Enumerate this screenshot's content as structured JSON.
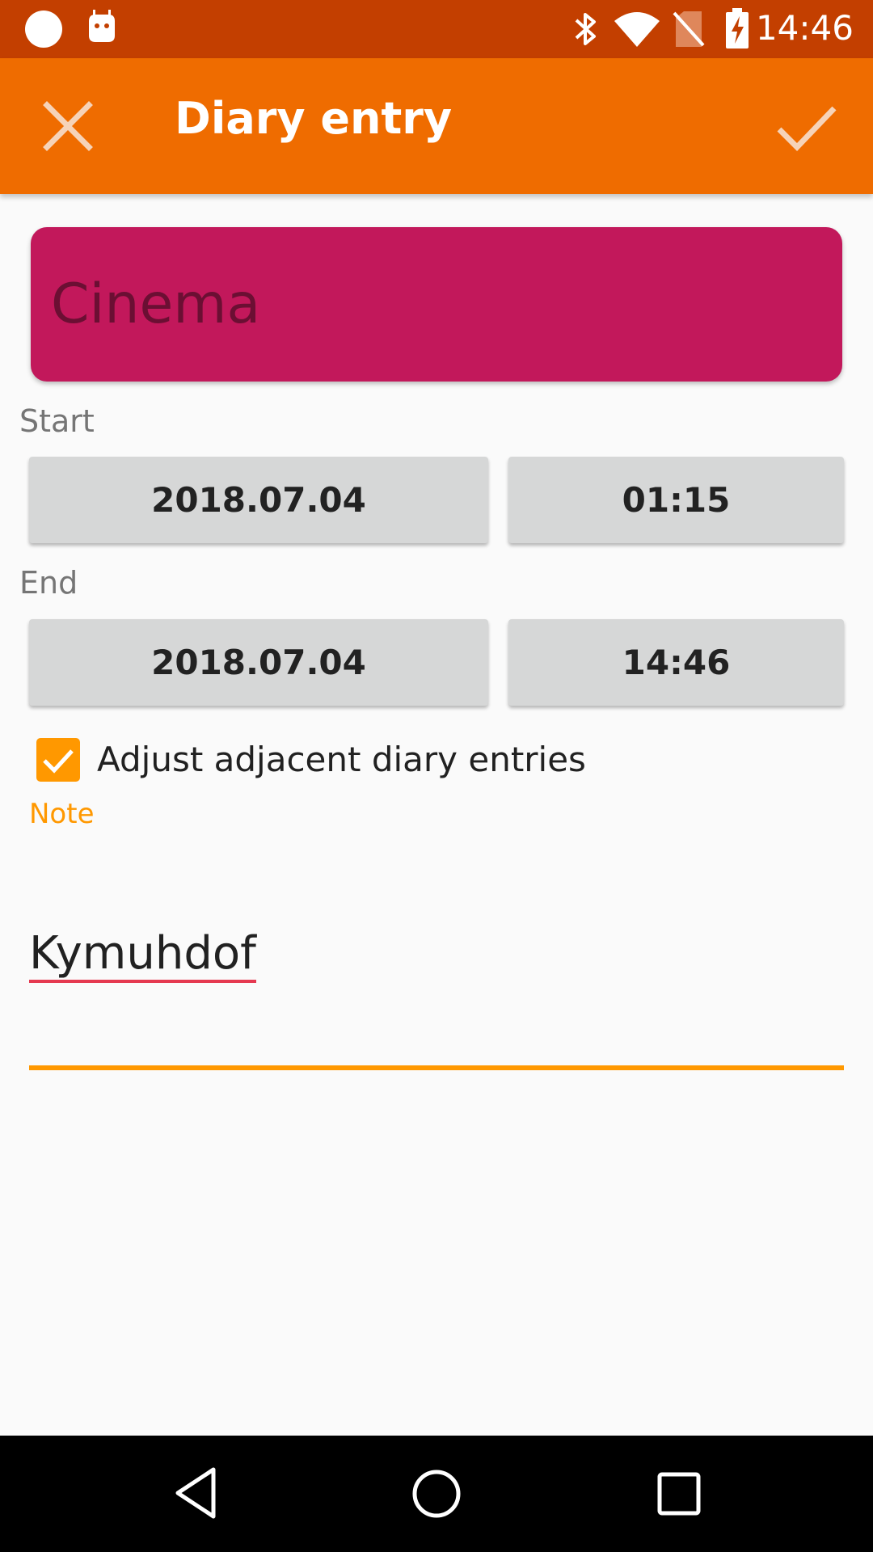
{
  "status_bar": {
    "time": "14:46",
    "icons": [
      "notification-dot-icon",
      "android-icon",
      "bluetooth-icon",
      "wifi-icon",
      "no-sim-icon",
      "battery-charging-icon"
    ]
  },
  "toolbar": {
    "title": "Diary entry",
    "close_icon": "close-icon",
    "confirm_icon": "check-icon"
  },
  "activity": {
    "name": "Cinema",
    "color": "#c2185b"
  },
  "start": {
    "label": "Start",
    "date": "2018.07.04",
    "time": "01:15"
  },
  "end": {
    "label": "End",
    "date": "2018.07.04",
    "time": "14:46"
  },
  "adjust": {
    "label": "Adjust adjacent diary entries",
    "checked": true
  },
  "note": {
    "label": "Note",
    "value": "Kymuhdof"
  },
  "colors": {
    "accent": "#ff9800",
    "toolbar": "#ef6c00",
    "status_bar": "#c33f00"
  },
  "nav_bar": {
    "icons": [
      "back-icon",
      "home-icon",
      "recents-icon"
    ]
  }
}
